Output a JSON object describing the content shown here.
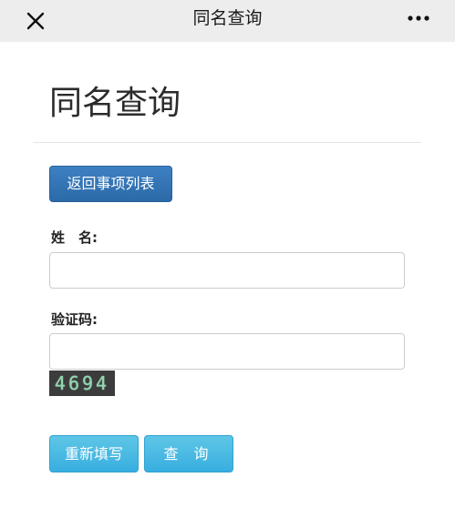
{
  "topbar": {
    "title": "同名查询",
    "close_icon": "close-icon",
    "more_icon": "more-dots-icon"
  },
  "page": {
    "heading": "同名查询"
  },
  "back_button": {
    "label": "返回事项列表"
  },
  "form": {
    "name_label": "姓　名:",
    "name_value": "",
    "captcha_label": "验证码:",
    "captcha_value": "",
    "captcha_code": "4694"
  },
  "actions": {
    "reset_label": "重新填写",
    "query_label": "查 询"
  },
  "colors": {
    "topbar_bg": "#ededed",
    "primary_blue": "#337ab7",
    "info_cyan": "#46b8da",
    "captcha_bg": "#3c3c3c"
  }
}
